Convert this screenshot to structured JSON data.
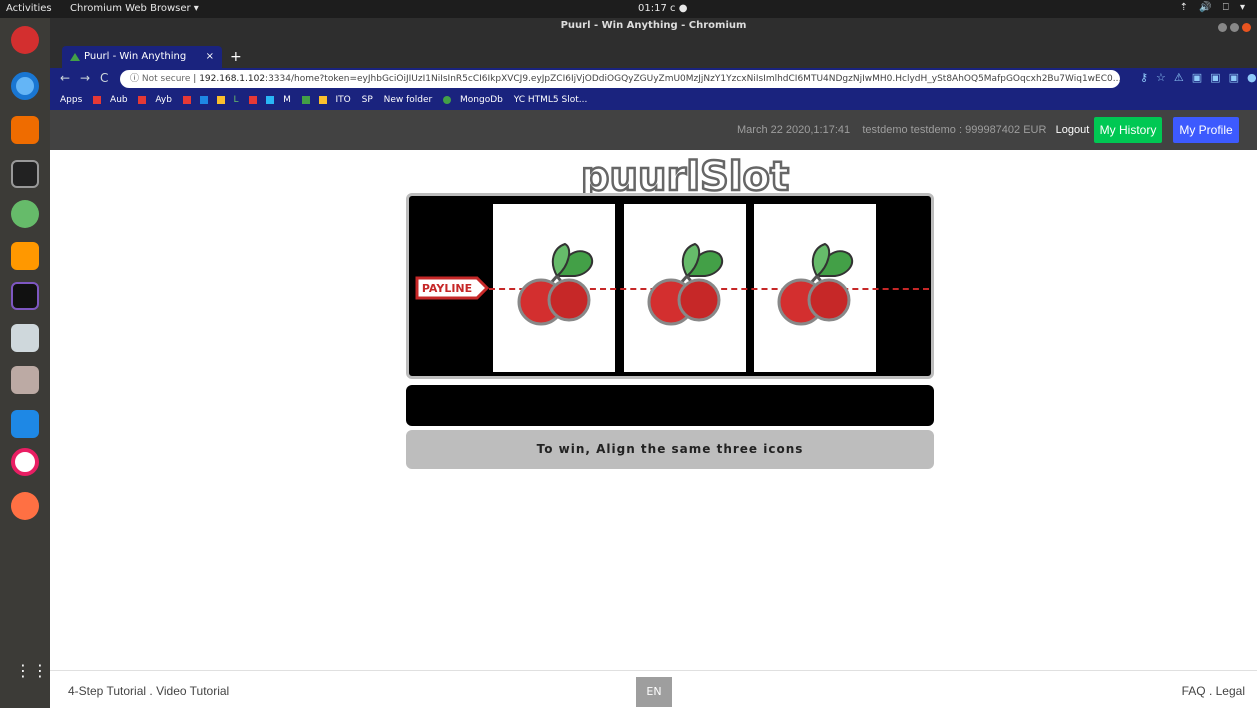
{
  "topbar": {
    "activities": "Activities",
    "app_menu": "Chromium Web Browser ▾",
    "clock": "01:17",
    "clock_extra": "c ●",
    "tray": "⇡ 🔊 ⎕ ▾"
  },
  "window": {
    "title": "Puurl - Win Anything - Chromium"
  },
  "tab": {
    "title": "Puurl - Win Anything",
    "close": "×",
    "new": "+"
  },
  "address": {
    "not_secure": "Not secure",
    "host": "192.168.1.102",
    "rest": ":3334/home?token=eyJhbGciOiJIUzI1NiIsInR5cCI6IkpXVCJ9.eyJpZCI6IjVjODdiOGQyZGUyZmU0MzJjNzY1YzcxNiIsImlhdCI6MTU4NDgzNjIwMH0.HclydH_ySt8AhOQ5MafpGOqcxh2Bu7Wiq1wEC0..."
  },
  "bookmarks": [
    "Apps",
    "Aub",
    "Ayb",
    "L",
    "M",
    "ITO",
    "SP",
    "New folder",
    "MongoDb",
    "YC HTML5 Slot..."
  ],
  "header": {
    "datetime": "March 22 2020,1:17:41",
    "user_balance": "testdemo testdemo : 999987402 EUR",
    "logout": "Logout",
    "history_btn": "My History",
    "profile_btn": "My Profile"
  },
  "game": {
    "logo": "puurlSlot",
    "payline": "PAYLINE",
    "reels": [
      "cherry",
      "cherry",
      "cherry"
    ],
    "message": "",
    "instruction": "To win, Align the same three icons"
  },
  "footer": {
    "tutorial": "4-Step Tutorial",
    "sep": " . ",
    "video": "Video Tutorial",
    "lang": "EN",
    "faq": "FAQ",
    "legal": "Legal"
  },
  "colors": {
    "history_btn": "#00c853",
    "profile_btn": "#3d5afe",
    "browser_theme": "#1a237e"
  }
}
